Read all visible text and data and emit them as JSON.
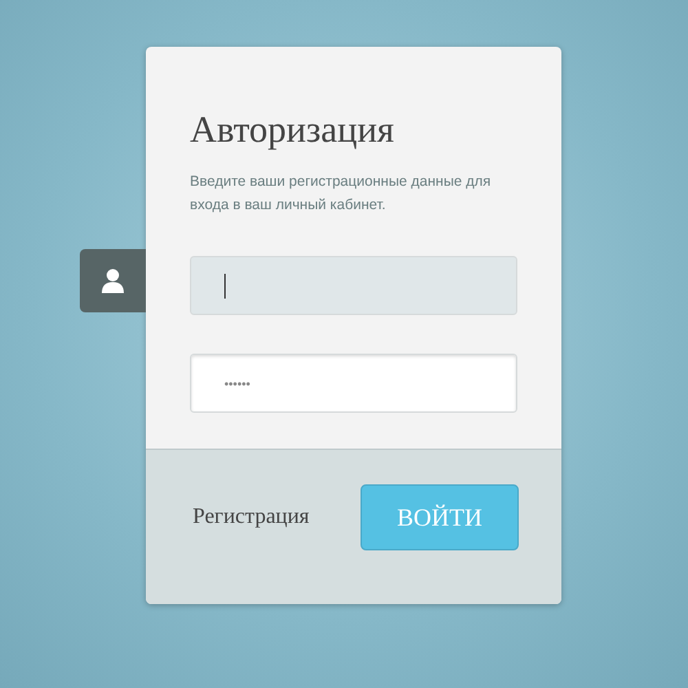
{
  "title": "Авторизация",
  "description": "Введите ваши регистрационные данные для входа в ваш личный кабинет.",
  "fields": [
    {
      "focused": true
    },
    {
      "focused": false,
      "value": "••••••"
    }
  ],
  "register_link": "Регистрация",
  "submit_button": "ВОЙТИ"
}
